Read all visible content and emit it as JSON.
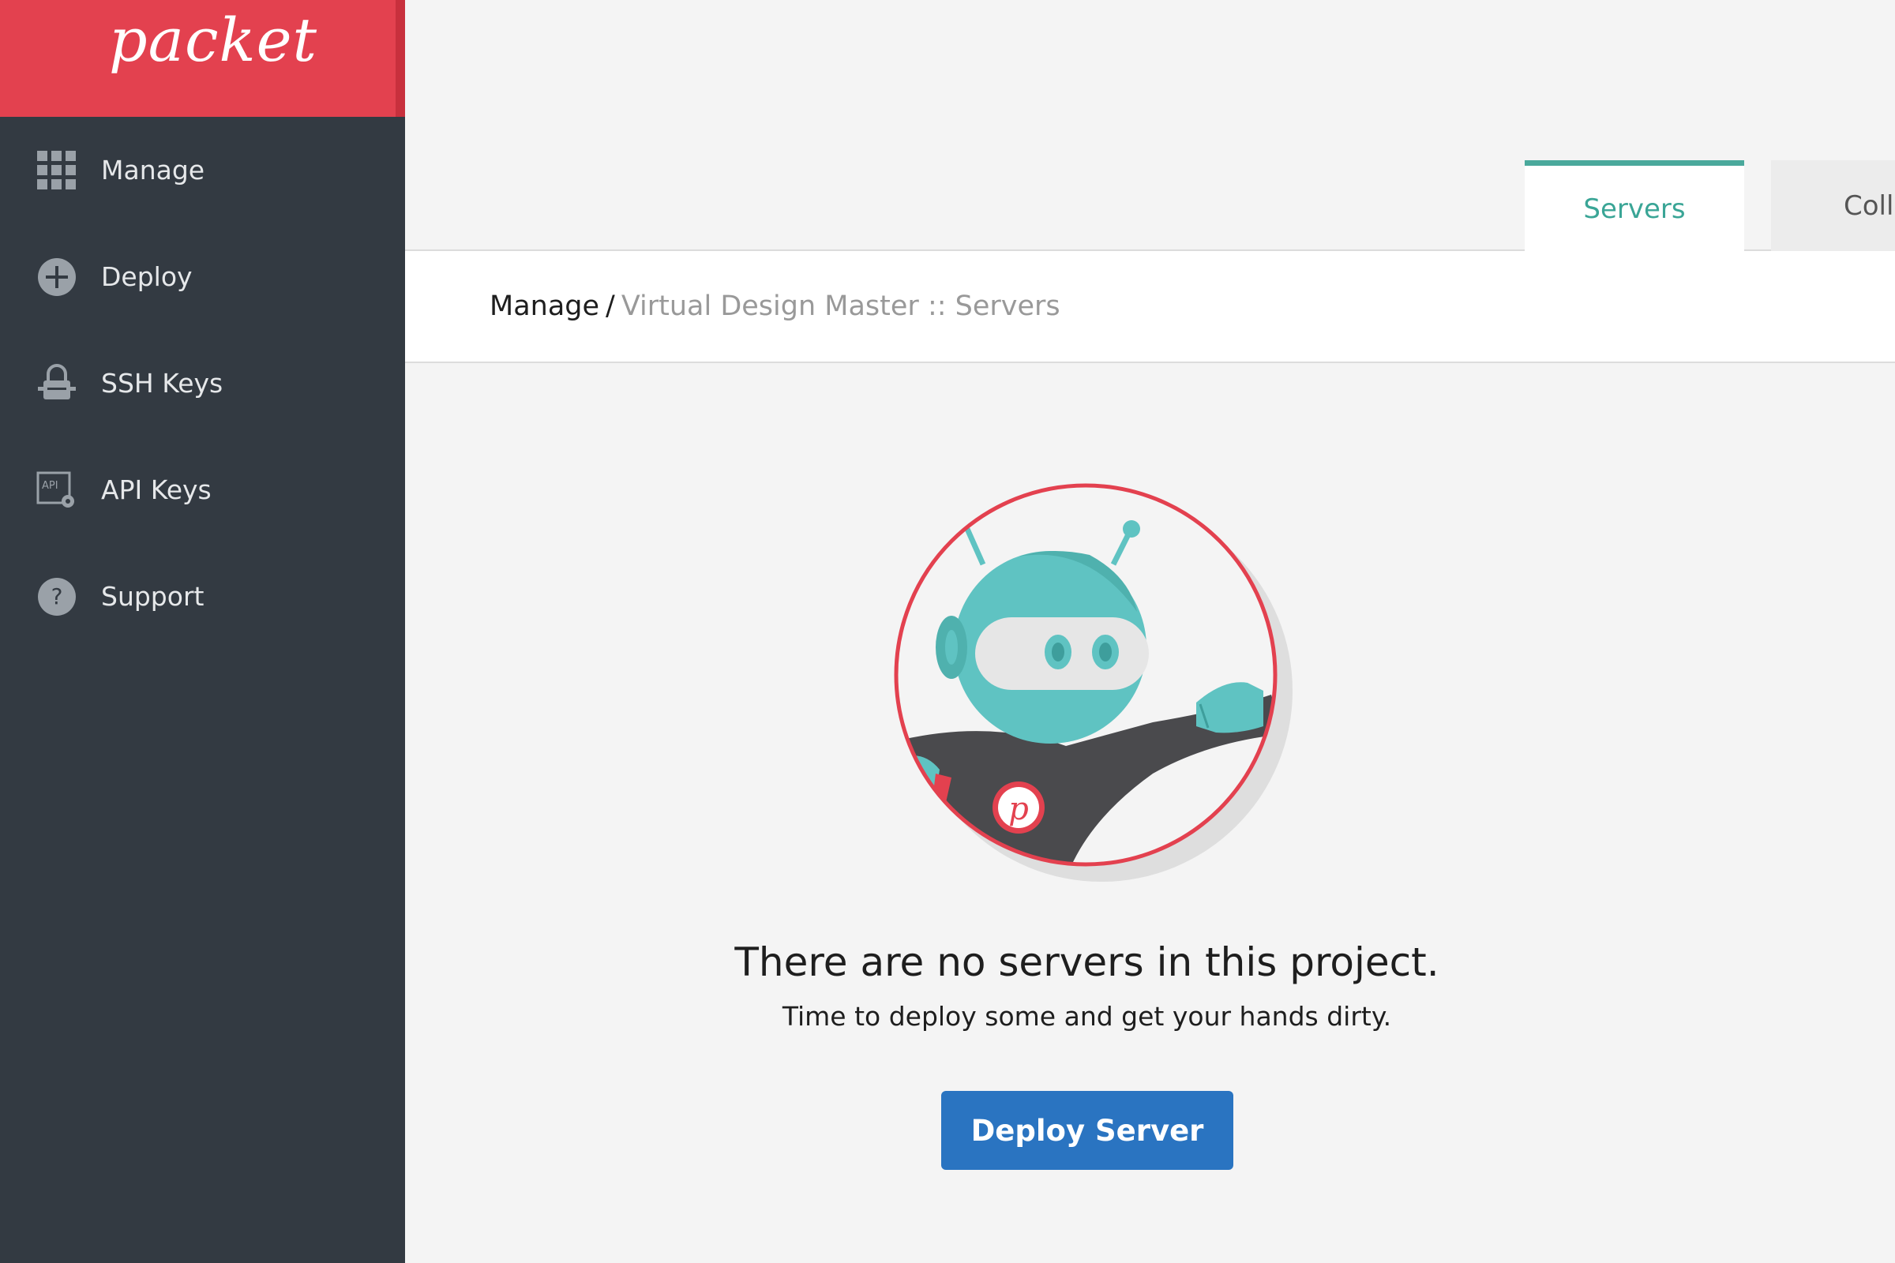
{
  "brand": {
    "logo_text": "packet"
  },
  "sidebar": {
    "items": [
      {
        "label": "Manage",
        "icon": "grid-icon"
      },
      {
        "label": "Deploy",
        "icon": "plus-circle-icon"
      },
      {
        "label": "SSH Keys",
        "icon": "lock-key-icon"
      },
      {
        "label": "API Keys",
        "icon": "api-gear-icon"
      },
      {
        "label": "Support",
        "icon": "question-circle-icon"
      }
    ]
  },
  "tabs": [
    {
      "label": "Servers",
      "active": true
    },
    {
      "label": "Colla",
      "active": false
    }
  ],
  "breadcrumb": {
    "root": "Manage",
    "separator": "/",
    "current": "Virtual Design Master :: Servers"
  },
  "empty_state": {
    "title": "There are no servers in this project.",
    "subtitle": "Time to deploy some and get your hands dirty.",
    "button_label": "Deploy Server",
    "illustration": "robot-mascot-icon"
  },
  "colors": {
    "brand_red": "#e3414f",
    "sidebar_bg": "#333a42",
    "tab_accent": "#4aa99c",
    "primary_button": "#2a74c1"
  }
}
